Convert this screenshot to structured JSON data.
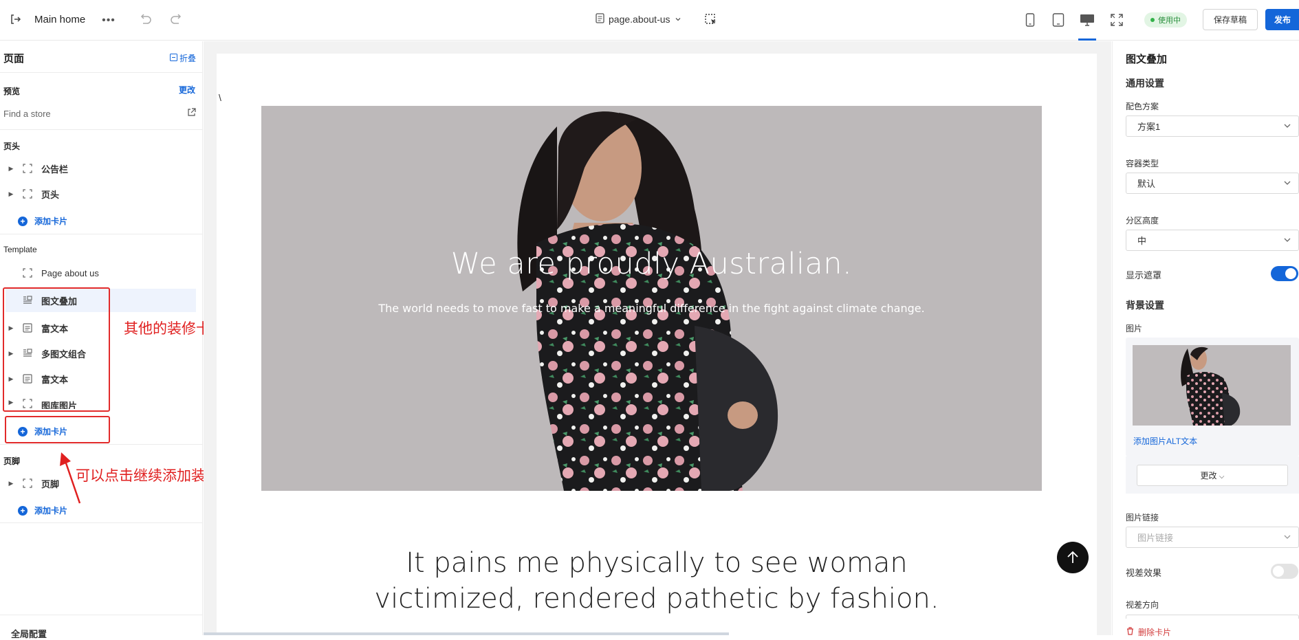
{
  "topbar": {
    "title": "Main home",
    "page_select": "page.about-us",
    "status": "使用中",
    "save_draft": "保存草稿",
    "publish": "发布"
  },
  "sidebar": {
    "heading": "页面",
    "collapse": "折叠",
    "preview_label": "预览",
    "preview_change": "更改",
    "preview_value": "Find a store",
    "header_section": "页头",
    "header_items": [
      "公告栏",
      "页头"
    ],
    "add_card": "添加卡片",
    "template_section": "Template",
    "template_root": "Page about us",
    "template_items": [
      "图文叠加",
      "富文本",
      "多图文组合",
      "富文本",
      "图库图片"
    ],
    "footer_section": "页脚",
    "footer_items": [
      "页脚"
    ],
    "global_config": "全局配置"
  },
  "annotations": {
    "other_cards": "其他的装修卡片",
    "click_to_add": "可以点击继续添加装修卡片"
  },
  "canvas": {
    "stray_char": "\\",
    "hero_title": "We are proudly Australian.",
    "hero_subtitle": "The world needs to move fast to make a meaningful difference in the fight against climate change.",
    "quote_line1": "It pains me physically to see woman",
    "quote_line2": "victimized, rendered pathetic by fashion."
  },
  "right_panel": {
    "title": "图文叠加",
    "general": "通用设置",
    "color_scheme_label": "配色方案",
    "color_scheme_value": "方案1",
    "container_label": "容器类型",
    "container_value": "默认",
    "height_label": "分区高度",
    "height_value": "中",
    "overlay_label": "显示遮罩",
    "overlay_on": true,
    "bg_section": "背景设置",
    "image_label": "图片",
    "alt_link": "添加图片ALT文本",
    "change_btn": "更改",
    "link_label": "图片链接",
    "link_placeholder": "图片链接",
    "parallax_label": "视差效果",
    "parallax_on": false,
    "parallax_dir_label": "视差方向",
    "delete_card": "删除卡片"
  },
  "colors": {
    "accent": "#1466d9",
    "annotation_red": "#e22a2a",
    "status_green": "#2a8f3d"
  }
}
